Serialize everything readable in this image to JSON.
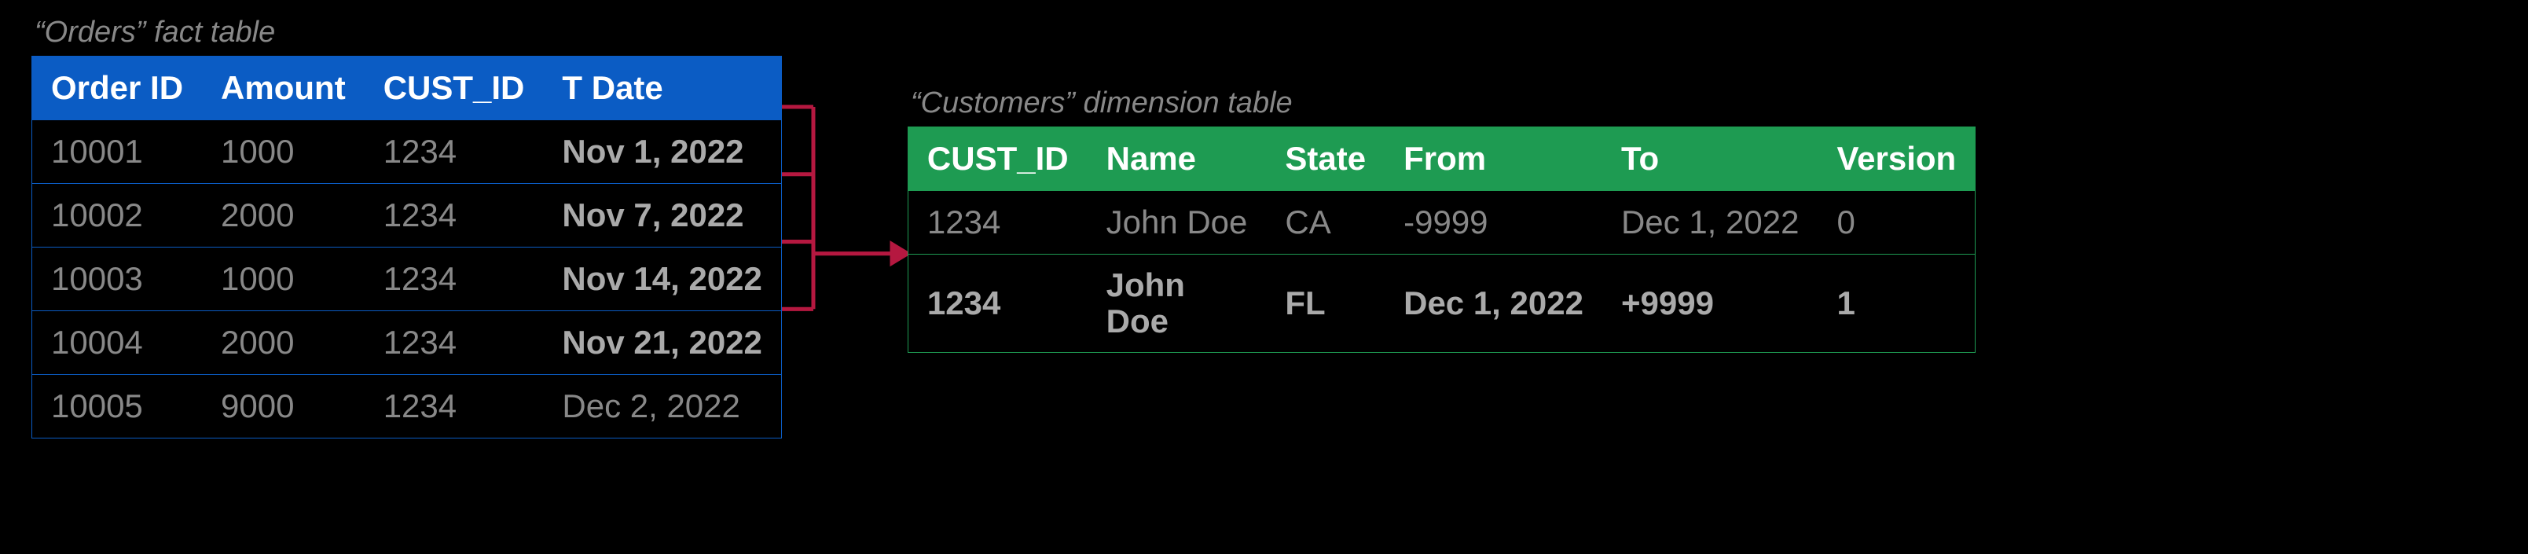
{
  "orders": {
    "caption": "“Orders” fact table",
    "headers": [
      "Order ID",
      "Amount",
      "CUST_ID",
      "T Date"
    ],
    "rows": [
      {
        "id": "10001",
        "amount": "1000",
        "cust": "1234",
        "date": "Nov 1, 2022",
        "bold": true
      },
      {
        "id": "10002",
        "amount": "2000",
        "cust": "1234",
        "date": "Nov 7, 2022",
        "bold": true
      },
      {
        "id": "10003",
        "amount": "1000",
        "cust": "1234",
        "date": "Nov 14, 2022",
        "bold": true
      },
      {
        "id": "10004",
        "amount": "2000",
        "cust": "1234",
        "date": "Nov 21, 2022",
        "bold": true
      },
      {
        "id": "10005",
        "amount": "9000",
        "cust": "1234",
        "date": "Dec 2, 2022",
        "bold": false
      }
    ]
  },
  "customers": {
    "caption": "“Customers” dimension table",
    "headers": [
      "CUST_ID",
      "Name",
      "State",
      "From",
      "To",
      "Version"
    ],
    "rows": [
      {
        "cust": "1234",
        "name": "John Doe",
        "state": "CA",
        "from": "-9999",
        "to": "Dec 1, 2022",
        "ver": "0",
        "active": false
      },
      {
        "cust": "1234",
        "name": "John\nDoe",
        "state": "FL",
        "from": "Dec 1, 2022",
        "to": "+9999",
        "ver": "1",
        "active": true
      }
    ]
  },
  "arrow_color": "#b51840"
}
